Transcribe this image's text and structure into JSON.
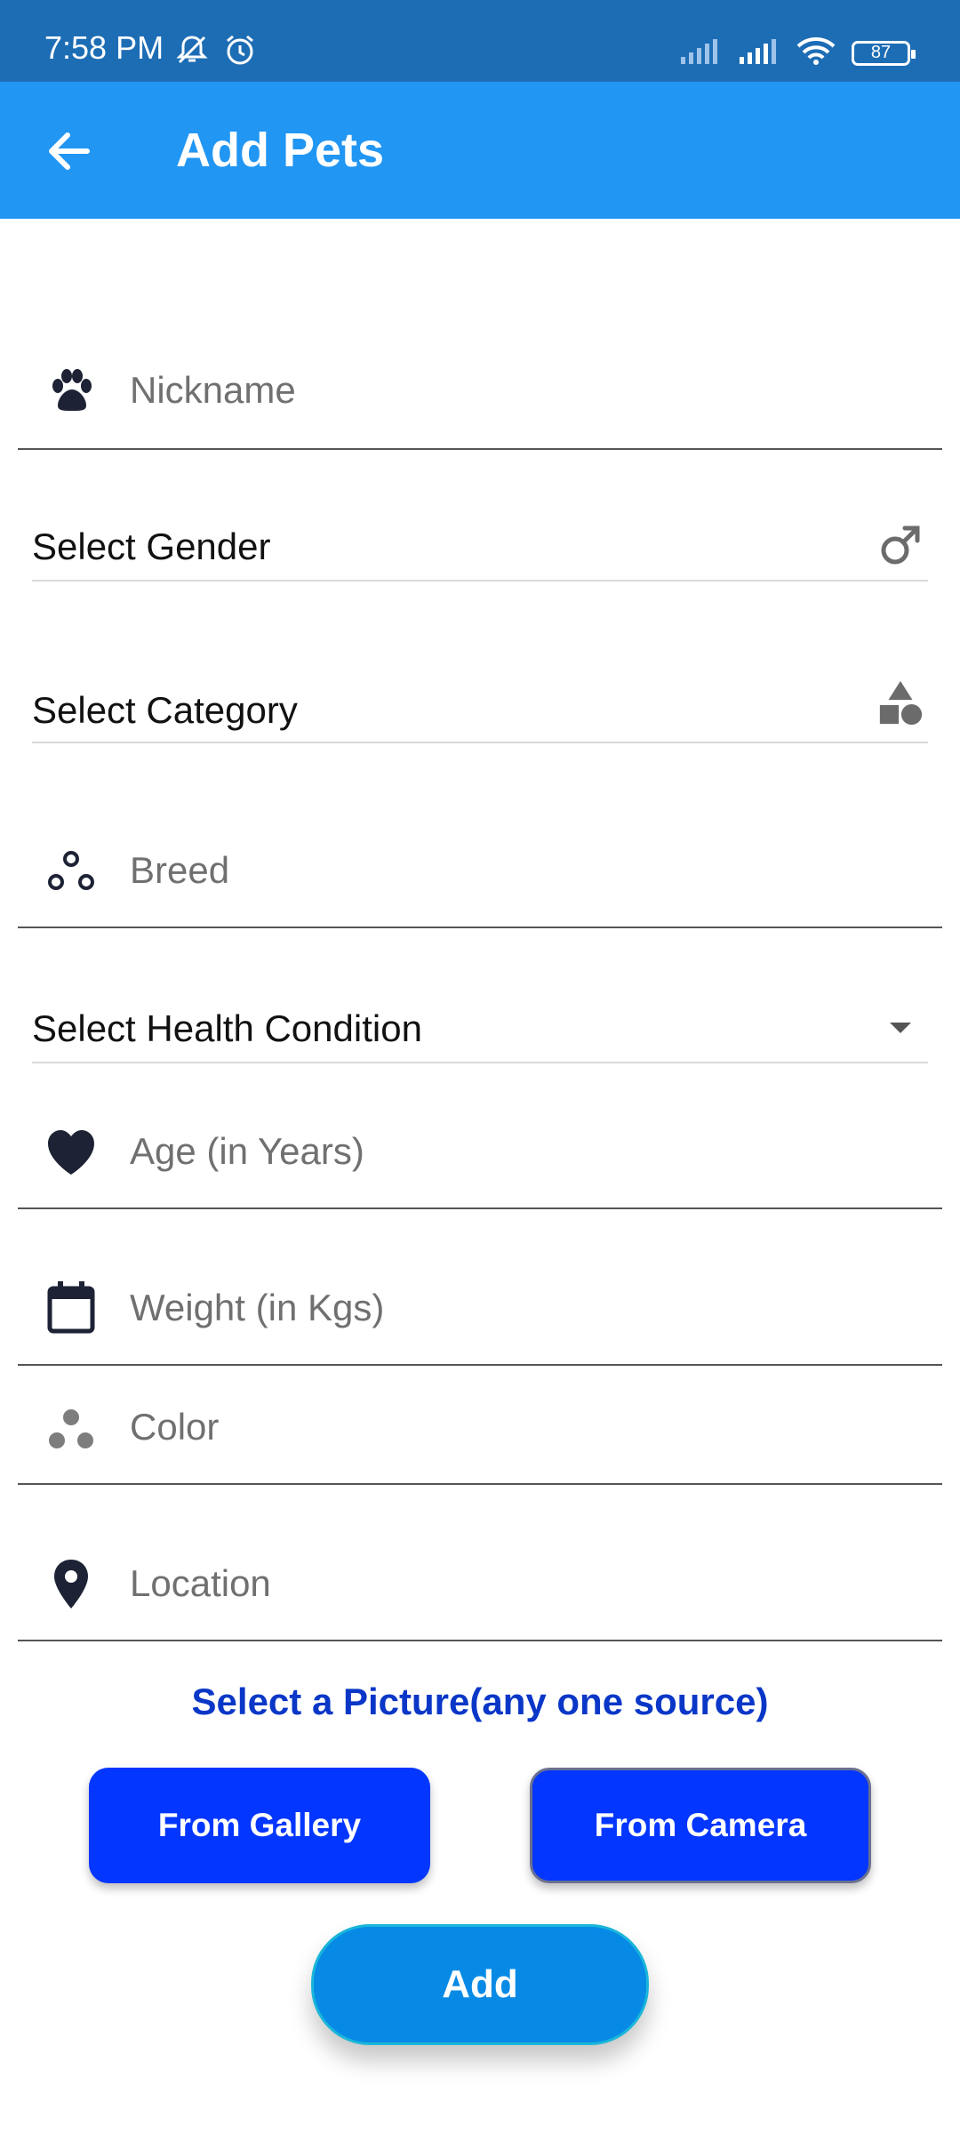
{
  "status_bar": {
    "time": "7:58 PM",
    "battery": "87",
    "icons": [
      "mute-icon",
      "alarm-icon",
      "signal-icon",
      "signal-icon",
      "wifi-icon",
      "battery-icon"
    ]
  },
  "app_bar": {
    "title": "Add Pets",
    "back_icon": "arrow-back-icon"
  },
  "form": {
    "nickname": {
      "placeholder": "Nickname",
      "icon": "paw-icon"
    },
    "gender": {
      "label": "Select Gender",
      "icon": "male-symbol-icon"
    },
    "category": {
      "label": "Select Category",
      "icon": "category-shapes-icon"
    },
    "breed": {
      "placeholder": "Breed",
      "icon": "bubbles-icon"
    },
    "health": {
      "label": "Select Health Condition",
      "icon": "dropdown-arrow-icon"
    },
    "age": {
      "placeholder": "Age (in Years)",
      "icon": "heart-icon"
    },
    "weight": {
      "placeholder": "Weight (in Kgs)",
      "icon": "calendar-icon"
    },
    "color": {
      "placeholder": "Color",
      "icon": "dots-icon"
    },
    "location": {
      "placeholder": "Location",
      "icon": "location-pin-icon"
    }
  },
  "picture": {
    "title": "Select a Picture(any one source)",
    "gallery_label": "From Gallery",
    "camera_label": "From Camera"
  },
  "add_label": "Add",
  "colors": {
    "status_bar": "#1d6db5",
    "app_bar": "#2196f3",
    "primary_button": "#0336ff",
    "add_button": "#078ae6",
    "section_title": "#0a37c7",
    "icon_dark": "#1e2235"
  }
}
